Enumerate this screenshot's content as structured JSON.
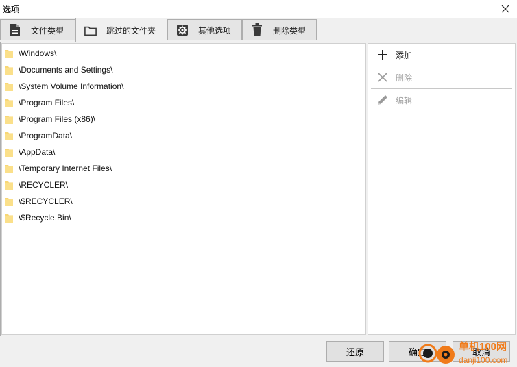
{
  "window": {
    "title": "选项",
    "close_glyph": "✕"
  },
  "tabs": [
    {
      "label": "文件类型",
      "icon": "document-icon"
    },
    {
      "label": "跳过的文件夹",
      "icon": "folder-outline-icon",
      "active": true
    },
    {
      "label": "其他选项",
      "icon": "gear-icon"
    },
    {
      "label": "删除类型",
      "icon": "trash-icon"
    }
  ],
  "folders": [
    "\\Windows\\",
    "\\Documents and Settings\\",
    "\\System Volume Information\\",
    "\\Program Files\\",
    "\\Program Files (x86)\\",
    "\\ProgramData\\",
    "\\AppData\\",
    "\\Temporary Internet Files\\",
    "\\RECYCLER\\",
    "\\$RECYCLER\\",
    "\\$Recycle.Bin\\"
  ],
  "actions": {
    "add": "添加",
    "delete": "删除",
    "edit": "编辑"
  },
  "buttons": {
    "restore": "还原",
    "ok": "确定",
    "cancel": "取消"
  },
  "watermark": {
    "line1": "单机100网",
    "line2": "danji100.com"
  },
  "colors": {
    "folder": "#f8d775",
    "disabled": "#a0a0a0",
    "watermark_orange": "#f07b1a"
  }
}
